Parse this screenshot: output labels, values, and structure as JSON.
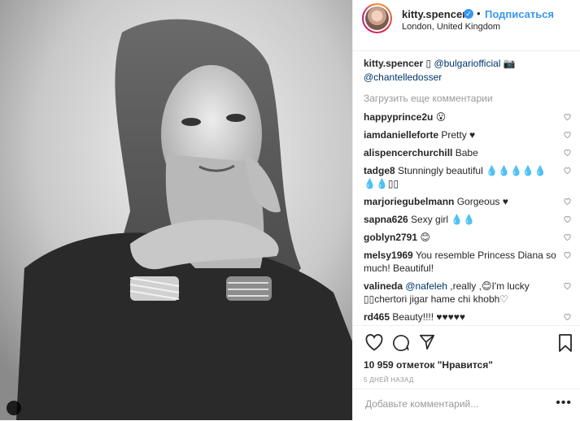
{
  "header": {
    "username": "kitty.spencer",
    "follow_label": "Подписаться",
    "separator": "•",
    "location": "London, United Kingdom"
  },
  "caption": {
    "username": "kitty.spencer",
    "symbol": "▯",
    "mention1": "@bulgariofficial",
    "camera": "📷",
    "mention2": "@chantelledosser"
  },
  "load_more_label": "Загрузить еще комментарии",
  "comments": [
    {
      "user": "happyprince2u",
      "text": "😮"
    },
    {
      "user": "iamdanielleforte",
      "text": "Pretty ♥"
    },
    {
      "user": "alispencerchurchill",
      "text": "Babe"
    },
    {
      "user": "tadge8",
      "text": "Stunningly beautiful 💧💧💧💧💧💧💧▯▯"
    },
    {
      "user": "marjoriegubelmann",
      "text": "Gorgeous ♥"
    },
    {
      "user": "sapna626",
      "text": "Sexy girl 💧💧"
    },
    {
      "user": "goblyn2791",
      "text": "😊"
    },
    {
      "user": "melsy1969",
      "text": "You resemble Princess Diana so much! Beautiful!"
    },
    {
      "user": "valineda",
      "mention": "@nafeleh",
      "text": ",really ,😊I'm lucky ▯▯chertori jigar hame chi khobh♡"
    },
    {
      "user": "rd465",
      "text": "Beauty!!!! ♥♥♥♥♥"
    }
  ],
  "likes_text": "10 959 отметок \"Нравится\"",
  "date_text": "5 ДНЕЙ НАЗАД",
  "comment_placeholder": "Добавьте комментарий...",
  "more_label": "•••",
  "colors": {
    "accent": "#3897f0",
    "link": "#003569",
    "muted": "#999999"
  }
}
